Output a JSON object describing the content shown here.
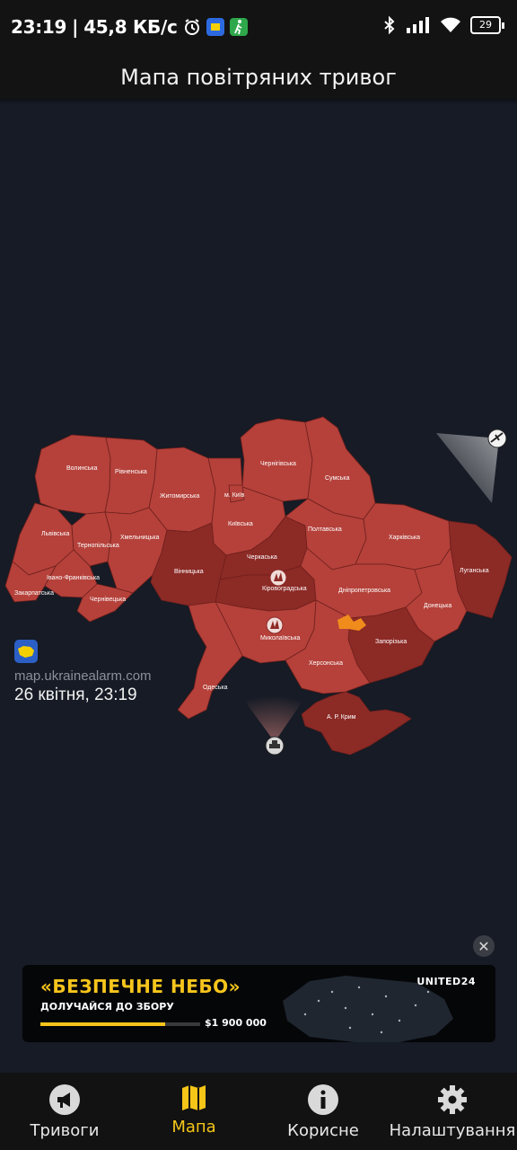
{
  "status_bar": {
    "time": "23:19",
    "speed": "45,8 КБ/с",
    "battery": "29"
  },
  "header": {
    "title": "Мапа повітряних тривог"
  },
  "map": {
    "regions": [
      {
        "id": "volyn",
        "label": "Волинська",
        "status": "alert"
      },
      {
        "id": "rivne",
        "label": "Рівненська",
        "status": "alert"
      },
      {
        "id": "zhytomyr",
        "label": "Житомирська",
        "status": "alert"
      },
      {
        "id": "chernihiv",
        "label": "Чернігівська",
        "status": "alert"
      },
      {
        "id": "sumy",
        "label": "Сумська",
        "status": "alert"
      },
      {
        "id": "kyiv_city",
        "label": "м. Київ",
        "status": "alert"
      },
      {
        "id": "kyiv",
        "label": "Київська",
        "status": "alert"
      },
      {
        "id": "lviv",
        "label": "Львівська",
        "status": "alert"
      },
      {
        "id": "ternopil",
        "label": "Тернопільська",
        "status": "alert"
      },
      {
        "id": "khmelnytskyi",
        "label": "Хмельницька",
        "status": "alert"
      },
      {
        "id": "ivano",
        "label": "Івано-Франківська",
        "status": "alert"
      },
      {
        "id": "zakarpattia",
        "label": "Закарпатська",
        "status": "alert"
      },
      {
        "id": "chernivtsi",
        "label": "Чернівецька",
        "status": "alert"
      },
      {
        "id": "vinnytsia",
        "label": "Вінницька",
        "status": "active"
      },
      {
        "id": "cherkasy",
        "label": "Черкаська",
        "status": "active"
      },
      {
        "id": "kirovohrad",
        "label": "Кіровоградська",
        "status": "active"
      },
      {
        "id": "poltava",
        "label": "Полтавська",
        "status": "alert"
      },
      {
        "id": "kharkiv",
        "label": "Харківська",
        "status": "alert"
      },
      {
        "id": "luhansk",
        "label": "Луганська",
        "status": "active"
      },
      {
        "id": "dnipro",
        "label": "Дніпропетровська",
        "status": "alert"
      },
      {
        "id": "donetsk",
        "label": "Донецька",
        "status": "alert"
      },
      {
        "id": "mykolaiv",
        "label": "Миколаївська",
        "status": "alert"
      },
      {
        "id": "zaporizhzhia",
        "label": "Запорізька",
        "status": "active"
      },
      {
        "id": "odesa",
        "label": "Одеська",
        "status": "alert"
      },
      {
        "id": "kherson",
        "label": "Херсонська",
        "status": "alert"
      },
      {
        "id": "crimea",
        "label": "А. Р. Крим",
        "status": "active"
      }
    ],
    "colors": {
      "alert": "#b5413a",
      "active": "#8c2a26",
      "border": "#6e1f1c",
      "highlight": "#f08c1c"
    }
  },
  "attribution": {
    "url": "map.ukrainealarm.com",
    "datetime": "26 квітня, 23:19"
  },
  "banner": {
    "title": "«БЕЗПЕЧНЕ НЕБО»",
    "subtitle": "ДОЛУЧАЙСЯ ДО ЗБОРУ",
    "amount": "$1 900 000",
    "brand": "UNITED24",
    "progress": 0.78,
    "close_icon": "close-icon"
  },
  "bottom_nav": {
    "items": [
      {
        "label": "Тривоги",
        "icon": "megaphone-icon",
        "active": false
      },
      {
        "label": "Мапа",
        "icon": "map-icon",
        "active": true
      },
      {
        "label": "Корисне",
        "icon": "info-icon",
        "active": false
      },
      {
        "label": "Налаштування",
        "icon": "gear-icon",
        "active": false
      }
    ]
  }
}
